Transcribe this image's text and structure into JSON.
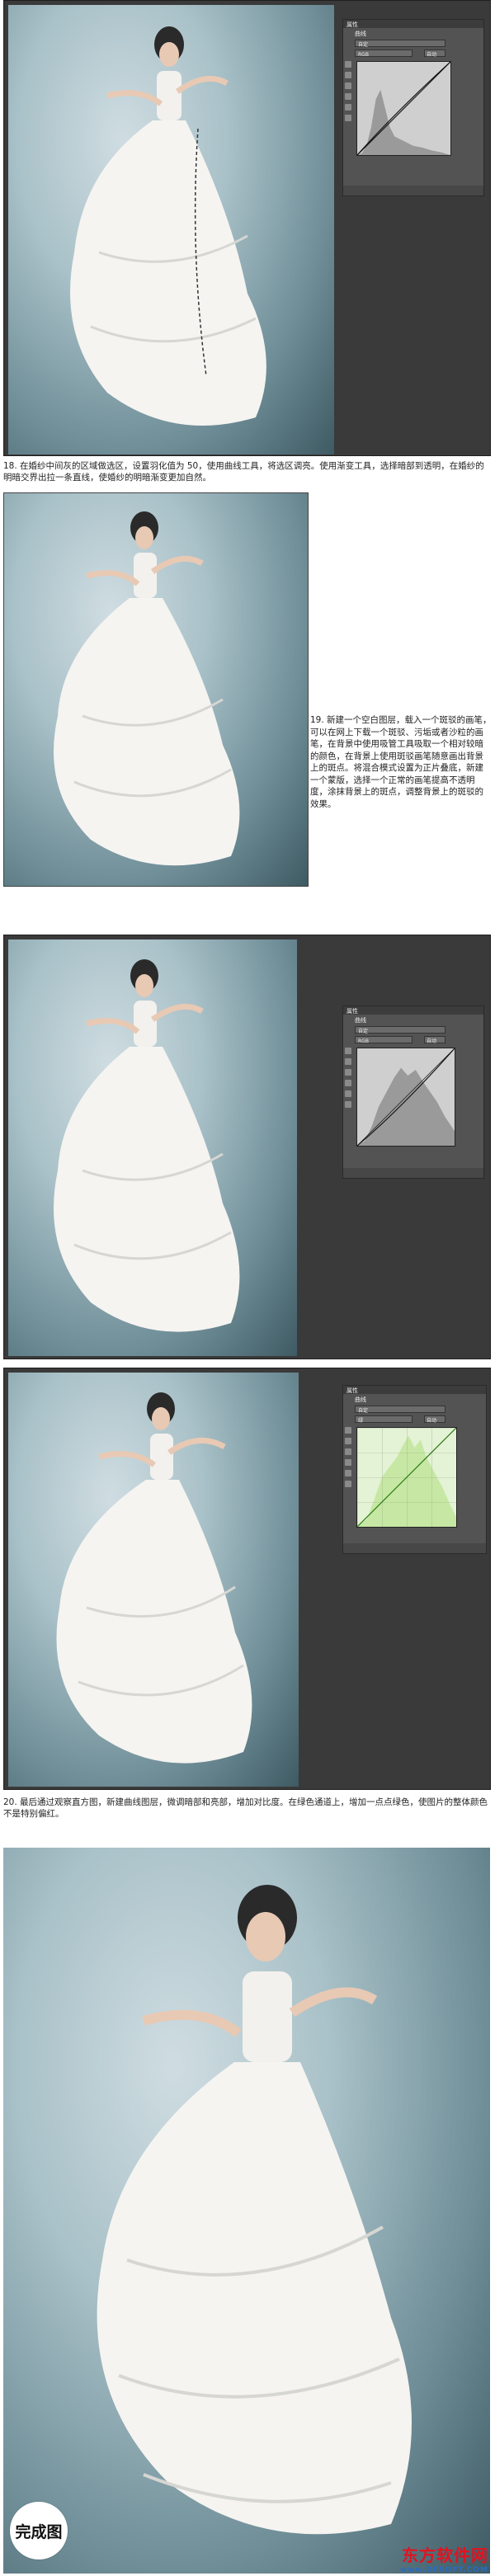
{
  "steps": {
    "step18": "18. 在婚纱中间灰的区域做选区，设置羽化值为 50，使用曲线工具，将选区调亮。使用渐变工具，选择暗部到透明，在婚纱的明暗交界出拉一条直线，使婚纱的明暗渐变更加自然。",
    "step19": "19. 新建一个空白图层，载入一个斑驳的画笔，可以在网上下载一个斑驳、污垢或者沙粒的画笔，在背景中使用吸管工具吸取一个相对较暗的颜色，在背景上使用斑驳画笔随意画出背景上的斑点。将混合模式设置为正片叠底，新建一个蒙版，选择一个正常的画笔提高不透明度，涂抹背景上的斑点，调整背景上的斑驳的效果。",
    "step20": "20. 最后通过观察直方图，新建曲线图层，微调暗部和亮部，增加对比度。在绿色通道上，增加一点点绿色，使图片的整体颜色不是特别偏红。"
  },
  "panels": {
    "panel1": {
      "tab": "属性",
      "title": "曲线",
      "preset": "自定",
      "channel": "RGB",
      "auto": "自动"
    },
    "panel3": {
      "tab": "属性",
      "title": "曲线",
      "preset": "自定",
      "channel": "RGB",
      "auto": "自动"
    },
    "panel4": {
      "tab": "属性",
      "title": "曲线",
      "preset": "自定",
      "channel": "绿",
      "auto": "自动"
    }
  },
  "final": {
    "badge": "完成图"
  },
  "watermark": {
    "line1": "东方软件网",
    "line2": "www.DFSOFT.COM"
  },
  "colors": {
    "frame": "#3a3a3a",
    "ps_panel": "#535353",
    "green_histogram": "#c6e8a4",
    "watermark_red": "#e2121f"
  }
}
